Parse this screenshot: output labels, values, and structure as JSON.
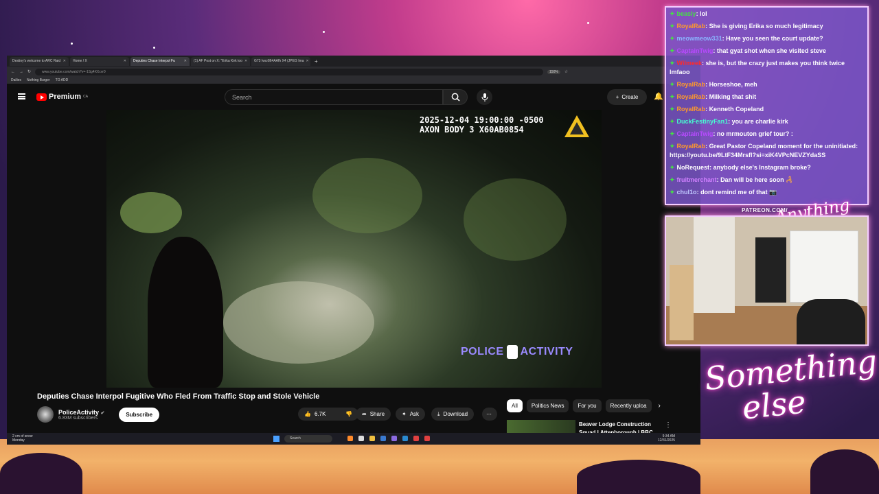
{
  "browser": {
    "tabs": [
      {
        "label": "Destiny's welcome to ARC Raid"
      },
      {
        "label": "Home / X"
      },
      {
        "label": "Deputies Chase Interpol Fu"
      },
      {
        "label": "(1) AF Post on X: \"Erika Kirk too"
      },
      {
        "label": "G73 Iwcr864AAfh X4 (JPEG Ima"
      }
    ],
    "url": "www.youtube.com/watch?v=-1Sg4XXcvr0",
    "zoom": "150%",
    "bookmarks": [
      "Dailies",
      "Nothing Burger",
      "TO ADD"
    ]
  },
  "youtube": {
    "brand": "Premium",
    "region": "CA",
    "search_placeholder": "Search",
    "create_label": "Create",
    "video": {
      "timestamp_line1": "2025-12-04 19:00:00 -0500",
      "timestamp_line2": "AXON BODY 3 X60AB0854",
      "watermark_left": "POLICE",
      "watermark_right": "ACTIVITY"
    },
    "title": "Deputies Chase Interpol Fugitive Who Fled From Traffic Stop and Stole Vehicle",
    "channel": {
      "name": "PoliceActivity",
      "verified": "✔",
      "subscribers": "6.83M subscribers",
      "subscribe_label": "Subscribe"
    },
    "actions": {
      "likes": "6.7K",
      "share": "Share",
      "ask": "Ask",
      "download": "Download"
    },
    "chips": [
      "All",
      "Politics News",
      "For you",
      "Recently uploa"
    ],
    "recommended_title": "Beaver Lodge Construction Squad | Attenborough | BBC"
  },
  "taskbar": {
    "weather_line1": "2 cm of snow",
    "weather_line2": "Monday",
    "search": "Search",
    "time": "9:34 AM",
    "date": "12/31/2025"
  },
  "chat": [
    {
      "user": "beasly",
      "color": "#46e046",
      "text": "lol"
    },
    {
      "user": "RoyalRab",
      "color": "#ff9a2a",
      "text": "She is giving Erika so much legitimacy"
    },
    {
      "user": "meowmeow331",
      "color": "#8ab4ff",
      "text": "Have you seen the court update?"
    },
    {
      "user": "CaptainTwig",
      "color": "#b84aff",
      "text": "that gyat shot when she visited steve"
    },
    {
      "user": "Wilmeek",
      "color": "#ff2a2a",
      "text": "she is, but the crazy just makes you think twice lmfaoo"
    },
    {
      "user": "RoyalRab",
      "color": "#ff9a2a",
      "text": "Horseshoe, meh"
    },
    {
      "user": "RoyalRab",
      "color": "#ff9a2a",
      "text": "Milking that shit"
    },
    {
      "user": "RoyalRab",
      "color": "#ff9a2a",
      "text": "Kenneth Copeland"
    },
    {
      "user": "DuckFestinyFan1",
      "color": "#46ffd0",
      "text": "you are charlie kirk"
    },
    {
      "user": "CaptainTwig",
      "color": "#b84aff",
      "text": "no mrmouton grief tour? :"
    },
    {
      "user": "RoyalRab",
      "color": "#ff9a2a",
      "text": "Great Pastor Copeland moment for the uninitiated: https://youtu.be/9LtF34Mrsfl?si=xiK4VPcNEVZYdaSS"
    },
    {
      "user": "NoRequest",
      "color": "#ffffff",
      "text": "anybody else's Instagram broke?"
    },
    {
      "user": "fruitmerchant",
      "color": "#d080ff",
      "text": "Dan will be here soon 🦂"
    },
    {
      "user": "chul1o",
      "color": "#c0c8ff",
      "text": "dont remind me of that 📷"
    }
  ],
  "overlay": {
    "patreon": "PATREON.COM/",
    "neon_small": "Anything else",
    "neon_big_1": "Something",
    "neon_big_2": "else"
  }
}
